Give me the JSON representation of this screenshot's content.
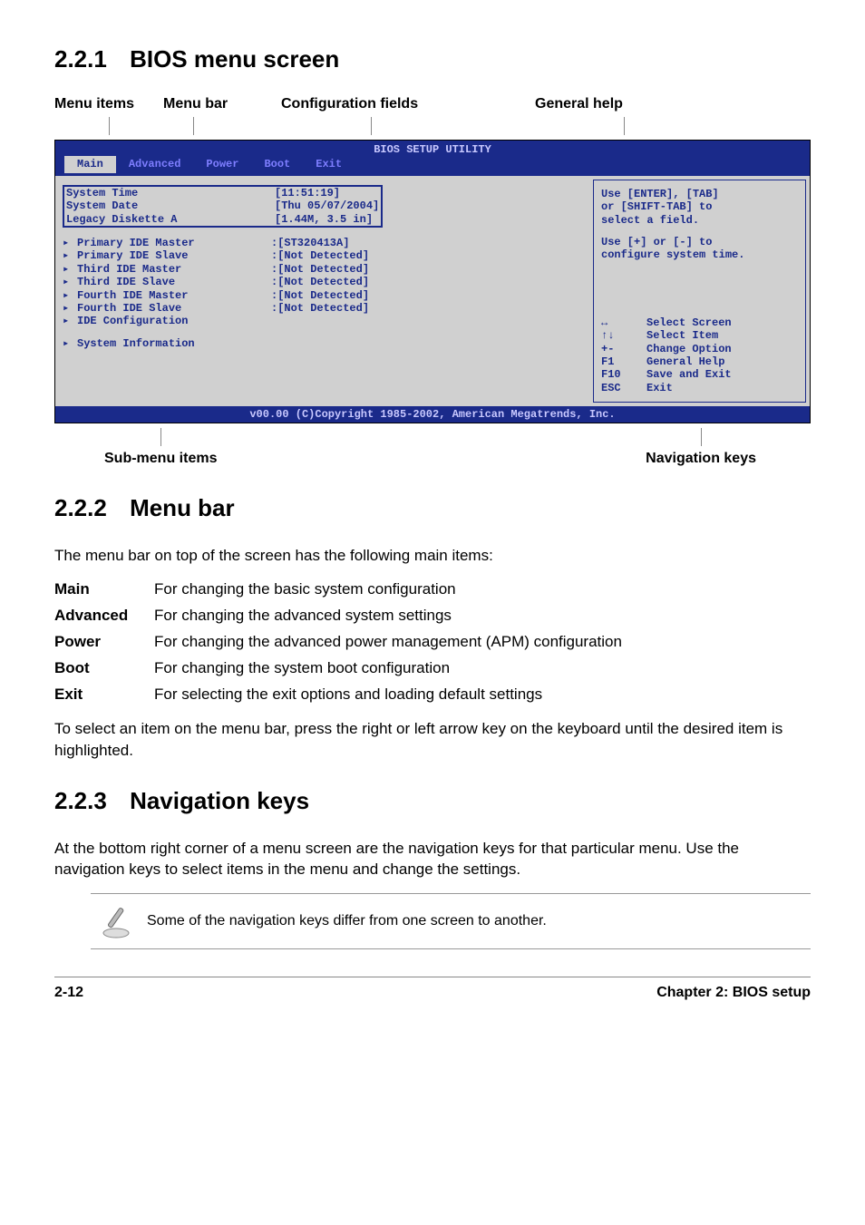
{
  "headings": {
    "s221_num": "2.2.1",
    "s221_title": "BIOS menu screen",
    "s222_num": "2.2.2",
    "s222_title": "Menu bar",
    "s223_num": "2.2.3",
    "s223_title": "Navigation keys"
  },
  "diagram_labels": {
    "menu_items": "Menu items",
    "menu_bar": "Menu bar",
    "config_fields": "Configuration fields",
    "general_help": "General help",
    "sub_menu": "Sub-menu items",
    "nav_keys": "Navigation keys"
  },
  "bios": {
    "title": "BIOS SETUP UTILITY",
    "tabs": [
      "Main",
      "Advanced",
      "Power",
      "Boot",
      "Exit"
    ],
    "fields": {
      "system_time_k": "System Time",
      "system_time_v": "[11:51:19]",
      "system_date_k": "System Date",
      "system_date_v": "[Thu 05/07/2004]",
      "legacy_k": "Legacy Diskette A",
      "legacy_v": "[1.44M, 3.5 in]",
      "pri_master_k": "Primary IDE Master",
      "pri_master_v": ":[ST320413A]",
      "pri_slave_k": "Primary IDE Slave",
      "pri_slave_v": ":[Not Detected]",
      "th_master_k": "Third IDE Master",
      "th_master_v": ":[Not Detected]",
      "th_slave_k": "Third IDE Slave",
      "th_slave_v": ":[Not Detected]",
      "fo_master_k": "Fourth IDE Master",
      "fo_master_v": ":[Not Detected]",
      "fo_slave_k": "Fourth IDE Slave",
      "fo_slave_v": ":[Not Detected]",
      "ide_conf_k": "IDE Configuration",
      "sys_info_k": "System Information"
    },
    "help": {
      "line1": "Use [ENTER], [TAB]",
      "line2": "or [SHIFT-TAB] to",
      "line3": "select a field.",
      "line4": "Use [+] or [-] to",
      "line5": "configure system time."
    },
    "nav": [
      {
        "key": "↔",
        "label": "Select Screen"
      },
      {
        "key": "↑↓",
        "label": "Select Item"
      },
      {
        "key": "+-",
        "label": "Change Option"
      },
      {
        "key": "F1",
        "label": "General Help"
      },
      {
        "key": "F10",
        "label": "Save and Exit"
      },
      {
        "key": "ESC",
        "label": "Exit"
      }
    ],
    "footer": "v00.00 (C)Copyright 1985-2002, American Megatrends, Inc."
  },
  "menubar_intro": "The menu bar on top of the screen has the following main items:",
  "menubar_items": [
    {
      "term": "Main",
      "desc": "For changing the basic system configuration"
    },
    {
      "term": "Advanced",
      "desc": "For changing the advanced system settings"
    },
    {
      "term": "Power",
      "desc": "For changing the advanced power management (APM) configuration"
    },
    {
      "term": "Boot",
      "desc": "For changing the system boot configuration"
    },
    {
      "term": "Exit",
      "desc": "For selecting the exit options and loading default settings"
    }
  ],
  "menubar_select": "To select an item on the menu bar, press the right or left arrow key on the keyboard until the desired item is highlighted.",
  "navkeys_body": "At the bottom right corner of a menu screen are the navigation keys for that particular menu. Use the navigation keys to select items in the menu and change the settings.",
  "note_text": "Some of the navigation keys differ from one screen to another.",
  "footer": {
    "page": "2-12",
    "chapter": "Chapter 2: BIOS setup"
  }
}
